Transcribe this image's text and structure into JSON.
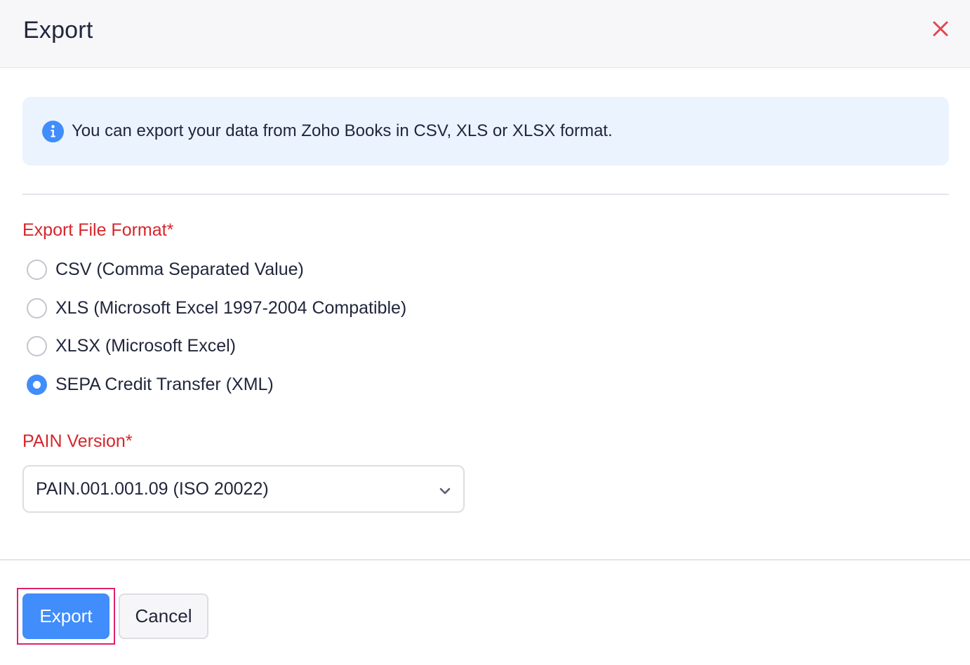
{
  "dialog": {
    "title": "Export",
    "close_icon": "close-icon"
  },
  "info": {
    "icon": "info-icon",
    "text": "You can export your data from Zoho Books in CSV, XLS or XLSX format."
  },
  "format": {
    "label": "Export File Format*",
    "options": [
      {
        "label": "CSV (Comma Separated Value)",
        "selected": false
      },
      {
        "label": "XLS (Microsoft Excel 1997-2004 Compatible)",
        "selected": false
      },
      {
        "label": "XLSX (Microsoft Excel)",
        "selected": false
      },
      {
        "label": "SEPA Credit Transfer (XML)",
        "selected": true
      }
    ]
  },
  "pain": {
    "label": "PAIN Version*",
    "selected": "PAIN.001.001.09 (ISO 20022)",
    "dropdown_icon": "chevron-down-icon"
  },
  "footer": {
    "export_label": "Export",
    "cancel_label": "Cancel"
  },
  "colors": {
    "accent": "#408dfb",
    "required_label": "#d6262b",
    "close": "#e0474c",
    "info_bg": "#ebf3ff",
    "highlight": "#e1206e"
  }
}
